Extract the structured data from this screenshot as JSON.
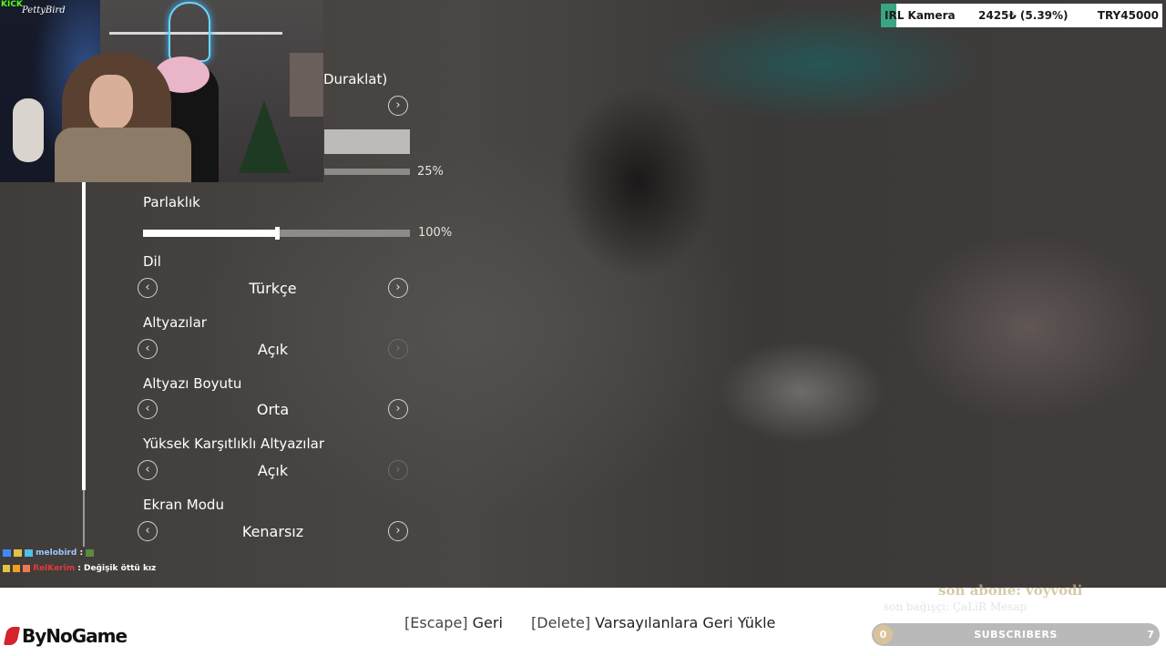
{
  "top_bar": {
    "name": "IRL Kamera",
    "current": "2425₺ (5.39%)",
    "target": "TRY45000",
    "progress_fraction": 0.0539,
    "fill_color": "#3aa583"
  },
  "webcam": {
    "platform_logo": "KICK",
    "signature": "PettyBird"
  },
  "settings": {
    "partial_row_label": "Duraklat)",
    "partial_slider_percent": "25%",
    "brightness": {
      "label": "Parlaklık",
      "percent_text": "100%",
      "level": 0.5
    },
    "rows": [
      {
        "label": "Dil",
        "value": "Türkçe",
        "right_enabled": true
      },
      {
        "label": "Altyazılar",
        "value": "Açık",
        "right_enabled": false
      },
      {
        "label": "Altyazı Boyutu",
        "value": "Orta",
        "right_enabled": true
      },
      {
        "label": "Yüksek Karşıtlıklı Altyazılar",
        "value": "Açık",
        "right_enabled": false
      },
      {
        "label": "Ekran Modu",
        "value": "Kenarsız",
        "right_enabled": true
      }
    ],
    "left_arrow_icon": "chevron-left-icon",
    "right_arrow_icon": "chevron-right-icon"
  },
  "chat": [
    {
      "user": "melobird",
      "message": ""
    },
    {
      "user": "RelKerim",
      "message": "Değişik öttü kız"
    }
  ],
  "footer": {
    "escape_key": "[Escape]",
    "escape_action": "Geri",
    "delete_key": "[Delete]",
    "delete_action": "Varsayılanlara Geri Yükle",
    "logo_text": "ByNoGame"
  },
  "overlay": {
    "last_sub": "son abone: voyvodi",
    "last_donation": "son bağışçı: ÇaLiR Mesap",
    "subscribers_label": "SUBSCRIBERS",
    "subscribers_start": "0",
    "subscribers_goal": "7"
  }
}
